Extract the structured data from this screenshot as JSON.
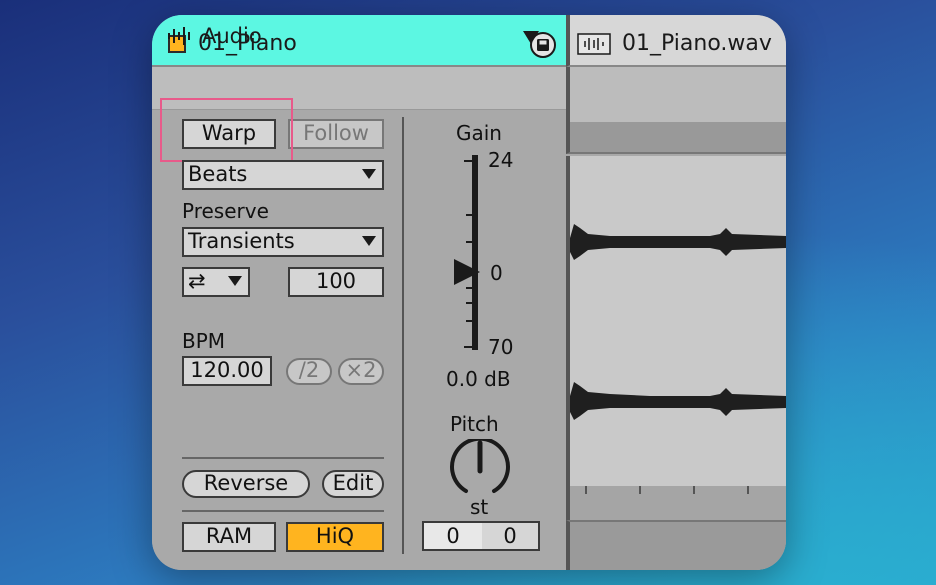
{
  "clip": {
    "name": "01_Piano",
    "color": "#ffb41f",
    "header_color": "#5cf7e2"
  },
  "audio": {
    "label": "Audio"
  },
  "warp": {
    "warp_label": "Warp",
    "follow_label": "Follow",
    "mode": "Beats",
    "preserve_label": "Preserve",
    "preserve_value": "Transients",
    "loop_mode_icon": "⇄",
    "transient_value": "100",
    "bpm_label": "BPM",
    "bpm_value": "120.00",
    "half_label": "/2",
    "double_label": "×2",
    "reverse_label": "Reverse",
    "edit_label": "Edit",
    "ram_label": "RAM",
    "hiq_label": "HiQ",
    "hiq_color": "#ffb41f"
  },
  "gain": {
    "label": "Gain",
    "max": "24",
    "zero": "0",
    "min": "70",
    "value": "0.0 dB"
  },
  "pitch": {
    "label": "Pitch",
    "unit": "st",
    "semitones": "0",
    "cents": "0"
  },
  "sample": {
    "name": "01_Piano.wav"
  }
}
